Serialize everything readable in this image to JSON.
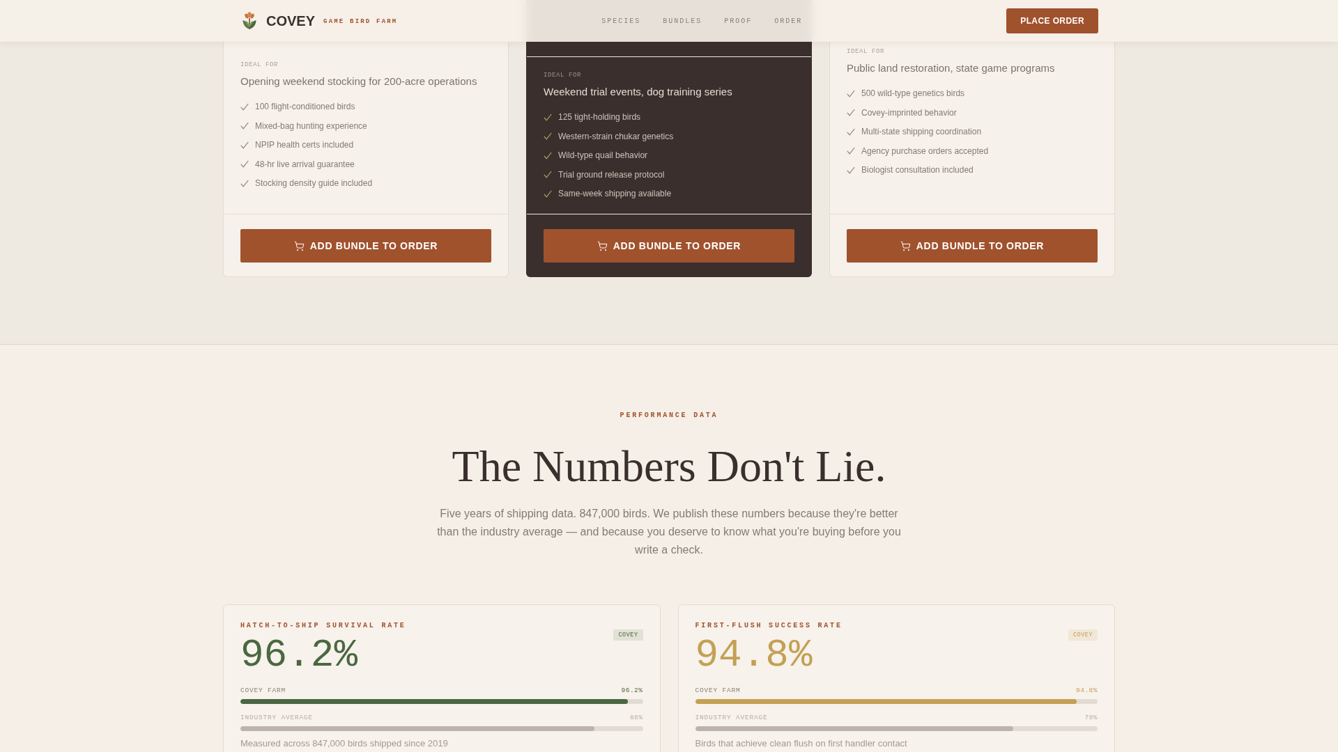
{
  "header": {
    "brand": "COVEY",
    "tagline": "GAME BIRD FARM",
    "nav": [
      {
        "label": "SPECIES"
      },
      {
        "label": "BUNDLES"
      },
      {
        "label": "PROOF"
      },
      {
        "label": "ORDER"
      }
    ],
    "cta": "PLACE ORDER"
  },
  "bundles": [
    {
      "kind": "standard",
      "ideal_for_label": "IDEAL FOR",
      "ideal_for": "Opening weekend stocking for 200-acre operations",
      "features": [
        "100 flight-conditioned birds",
        "Mixed-bag hunting experience",
        "NPIP health certs included",
        "48-hr live arrival guarantee",
        "Stocking density guide included"
      ],
      "button": "ADD BUNDLE TO ORDER"
    },
    {
      "kind": "featured",
      "ideal_for_label": "IDEAL FOR",
      "ideal_for": "Weekend trial events, dog training series",
      "features": [
        "125 tight-holding birds",
        "Western-strain chukar genetics",
        "Wild-type quail behavior",
        "Trial ground release protocol",
        "Same-week shipping available"
      ],
      "button": "ADD BUNDLE TO ORDER"
    },
    {
      "kind": "standard",
      "ideal_for_label": "IDEAL FOR",
      "ideal_for": "Public land restoration, state game programs",
      "features": [
        "500 wild-type genetics birds",
        "Covey-imprinted behavior",
        "Multi-state shipping coordination",
        "Agency purchase orders accepted",
        "Biologist consultation included"
      ],
      "button": "ADD BUNDLE TO ORDER"
    }
  ],
  "performance": {
    "eyebrow": "PERFORMANCE DATA",
    "title": "The Numbers Don't Lie.",
    "intro": "Five years of shipping data. 847,000 birds. We publish these numbers because they're better than the industry average — and because you deserve to know what you're buying before you write a check.",
    "stats": [
      {
        "title": "HATCH-TO-SHIP SURVIVAL RATE",
        "value": "96.2%",
        "color": "#4a6741",
        "badge": "COVEY",
        "bars": [
          {
            "kind": "farm",
            "label": "COVEY FARM",
            "reading": "96.2%",
            "level": 0.962
          },
          {
            "kind": "industry",
            "label": "INDUSTRY AVERAGE",
            "reading": "88%",
            "level": 0.88
          }
        ],
        "note": "Measured across 847,000 birds shipped since 2019"
      },
      {
        "title": "FIRST-FLUSH SUCCESS RATE",
        "value": "94.8%",
        "color": "#c4a055",
        "badge": "COVEY",
        "bars": [
          {
            "kind": "farm",
            "label": "COVEY FARM",
            "reading": "94.8%",
            "level": 0.948
          },
          {
            "kind": "industry",
            "label": "INDUSTRY AVERAGE",
            "reading": "79%",
            "level": 0.79
          }
        ],
        "note": "Birds that achieve clean flush on first handler contact"
      }
    ]
  }
}
